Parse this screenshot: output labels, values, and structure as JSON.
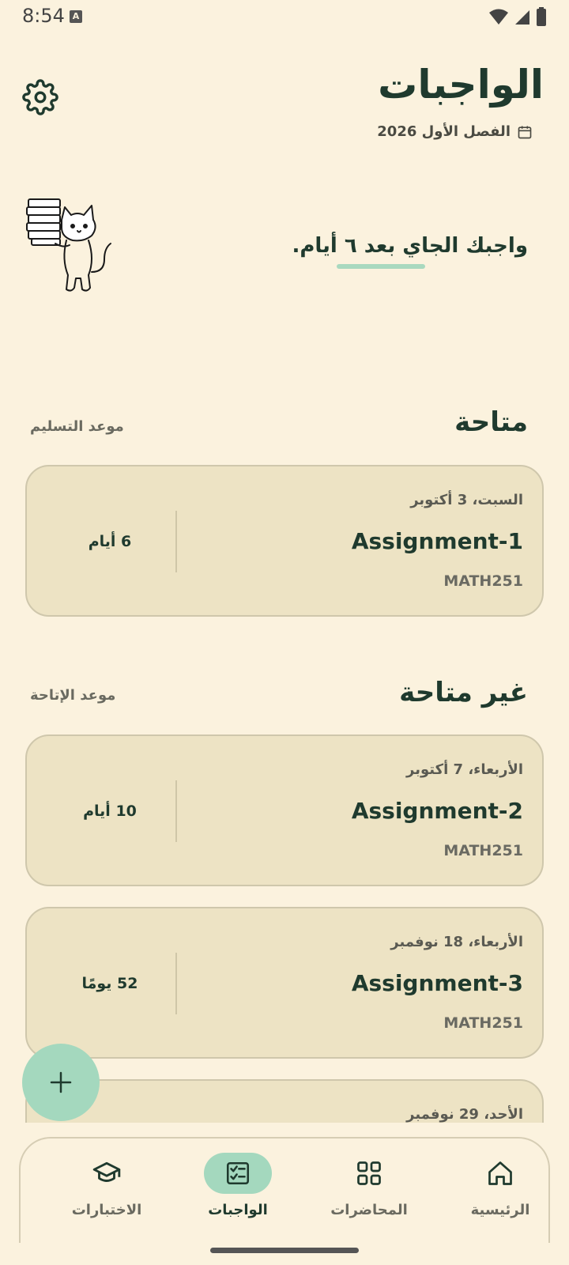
{
  "status_bar": {
    "time": "8:54",
    "notification_badge": "A"
  },
  "header": {
    "title": "الواجبات",
    "semester": "الفصل الأول 2026"
  },
  "banner": {
    "message": "واجبك الجاي بعد ٦ أيام."
  },
  "sections": [
    {
      "title": "متاحة",
      "subtitle": "موعد التسليم"
    },
    {
      "title": "غير متاحة",
      "subtitle": "موعد الإتاحة"
    }
  ],
  "cards": [
    {
      "date": "السبت، 3 أكتوبر",
      "title": "Assignment-1",
      "course": "MATH251",
      "remaining": "6 أيام"
    },
    {
      "date": "الأربعاء، 7 أكتوبر",
      "title": "Assignment-2",
      "course": "MATH251",
      "remaining": "10 أيام"
    },
    {
      "date": "الأربعاء، 18 نوفمبر",
      "title": "Assignment-3",
      "course": "MATH251",
      "remaining": "52 يومًا"
    },
    {
      "date": "الأحد، 29 نوفمبر"
    }
  ],
  "bottom_nav": [
    {
      "label": "الاختبارات",
      "icon": "graduation-cap-icon"
    },
    {
      "label": "الواجبات",
      "icon": "checklist-icon",
      "active": true
    },
    {
      "label": "المحاضرات",
      "icon": "grid-icon"
    },
    {
      "label": "الرئيسية",
      "icon": "home-icon"
    }
  ],
  "colors": {
    "background": "#FBF2DE",
    "card": "#EDE3C4",
    "accent": "#A4D8BE",
    "text": "#1F3A2E"
  }
}
